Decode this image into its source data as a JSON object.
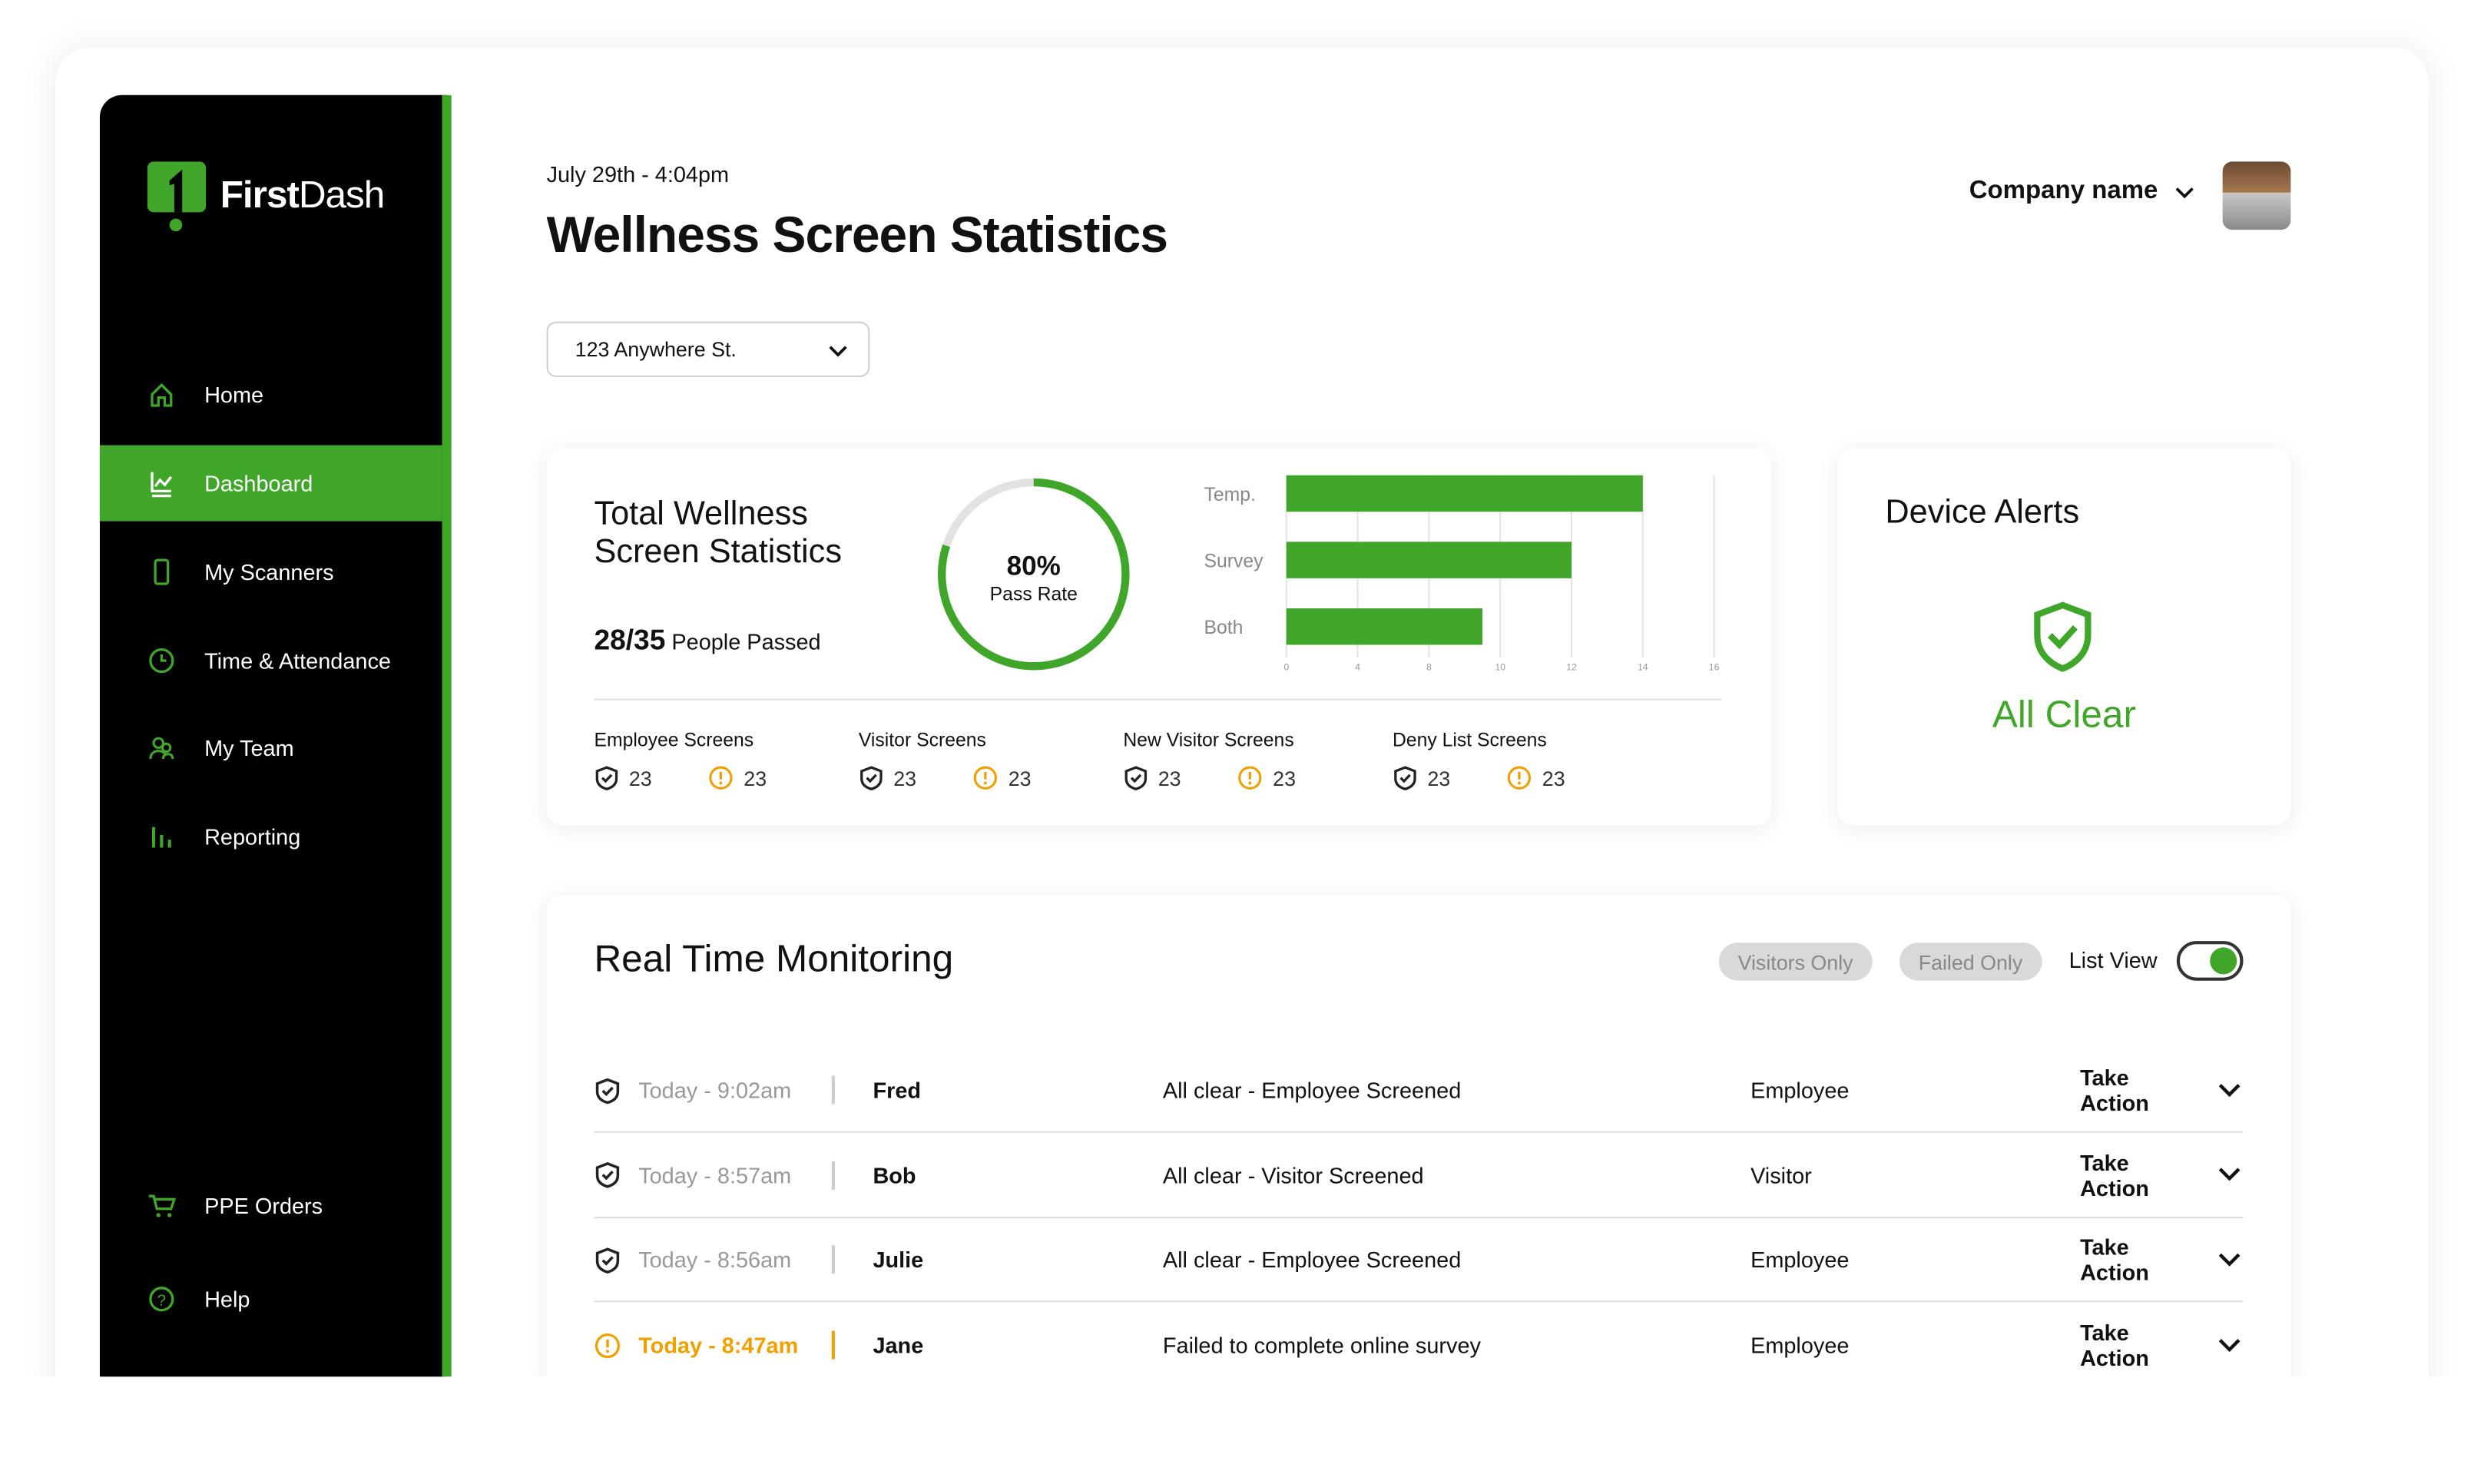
{
  "brand": {
    "name_bold": "First",
    "name_light": "Dash",
    "color": "#3fa62a"
  },
  "sidebar": {
    "items": [
      {
        "label": "Home",
        "icon": "home-icon"
      },
      {
        "label": "Dashboard",
        "icon": "chart-line-icon",
        "active": true
      },
      {
        "label": "My Scanners",
        "icon": "phone-icon"
      },
      {
        "label": "Time & Attendance",
        "icon": "clock-icon"
      },
      {
        "label": "My Team",
        "icon": "team-icon"
      },
      {
        "label": "Reporting",
        "icon": "bar-chart-icon"
      }
    ],
    "bottom": [
      {
        "label": "PPE Orders",
        "icon": "cart-icon"
      },
      {
        "label": "Help",
        "icon": "help-icon"
      }
    ]
  },
  "header": {
    "datetime": "July 29th - 4:04pm",
    "title": "Wellness Screen Statistics",
    "location": "123 Anywhere St.",
    "company": "Company name"
  },
  "stats": {
    "title_line1": "Total Wellness",
    "title_line2": "Screen Statistics",
    "passed": "28/35",
    "passed_label": "People Passed",
    "pass_rate": "80%",
    "pass_rate_value": 80,
    "pass_rate_label": "Pass Rate",
    "screens": [
      {
        "label": "Employee Screens",
        "passed": "23",
        "alerts": "23"
      },
      {
        "label": "Visitor Screens",
        "passed": "23",
        "alerts": "23"
      },
      {
        "label": "New Visitor Screens",
        "passed": "23",
        "alerts": "23"
      },
      {
        "label": "Deny List Screens",
        "passed": "23",
        "alerts": "23"
      }
    ]
  },
  "chart_data": {
    "type": "bar",
    "orientation": "horizontal",
    "categories": [
      "Temp.",
      "Survey",
      "Both"
    ],
    "values": [
      14,
      12,
      9.5
    ],
    "x_ticks": [
      "0",
      "4",
      "8",
      "10",
      "12",
      "14",
      "16"
    ],
    "grid": true,
    "color": "#3fa62a"
  },
  "alerts": {
    "title": "Device Alerts",
    "status": "All Clear"
  },
  "monitoring": {
    "title": "Real Time Monitoring",
    "filters": [
      "Visitors Only",
      "Failed Only"
    ],
    "list_view_label": "List View",
    "list_view_on": true,
    "rows": [
      {
        "time": "Today - 9:02am",
        "name": "Fred",
        "message": "All clear - Employee Screened",
        "type": "Employee",
        "action": "Take Action",
        "status": "clear"
      },
      {
        "time": "Today - 8:57am",
        "name": "Bob",
        "message": "All clear - Visitor Screened",
        "type": "Visitor",
        "action": "Take Action",
        "status": "clear"
      },
      {
        "time": "Today - 8:56am",
        "name": "Julie",
        "message": "All clear - Employee Screened",
        "type": "Employee",
        "action": "Take Action",
        "status": "clear"
      },
      {
        "time": "Today - 8:47am",
        "name": "Jane",
        "message": "Failed to complete online survey",
        "type": "Employee",
        "action": "Take Action",
        "status": "warning"
      }
    ]
  },
  "colors": {
    "accent": "#3fa62a",
    "warning": "#f0a000"
  }
}
